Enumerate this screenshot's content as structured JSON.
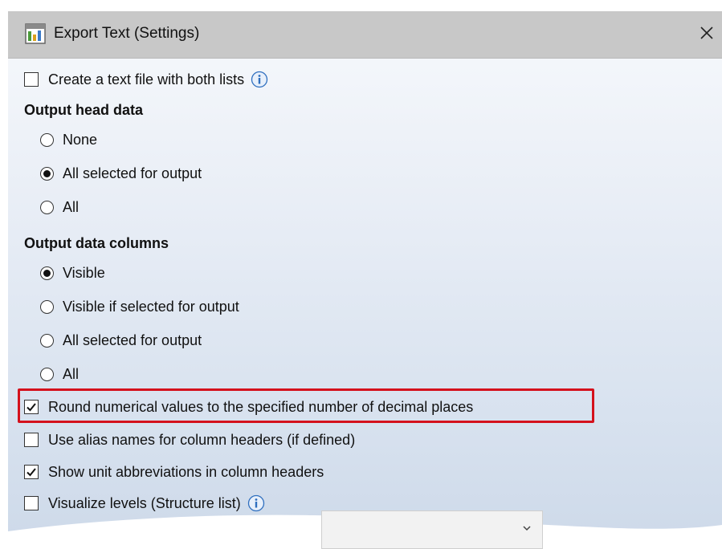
{
  "window": {
    "title": "Export Text (Settings)",
    "close_glyph": "✕"
  },
  "options": {
    "both_lists": {
      "label": "Create a text file with both lists",
      "checked": false,
      "icon": "info-icon"
    },
    "head_data": {
      "heading": "Output head data",
      "items": [
        {
          "label": "None",
          "selected": false
        },
        {
          "label": "All selected for output",
          "selected": true
        },
        {
          "label": "All",
          "selected": false
        }
      ]
    },
    "data_columns": {
      "heading": "Output data columns",
      "items": [
        {
          "label": "Visible",
          "selected": true
        },
        {
          "label": "Visible if selected for output",
          "selected": false
        },
        {
          "label": "All selected for output",
          "selected": false
        },
        {
          "label": "All",
          "selected": false
        }
      ]
    },
    "round_values": {
      "label": "Round numerical values to the specified number of decimal places",
      "checked": true
    },
    "alias_names": {
      "label": "Use alias names for column headers (if defined)",
      "checked": false
    },
    "unit_abbrev": {
      "label": "Show unit abbreviations in column headers",
      "checked": true
    },
    "visualize_levels": {
      "label": "Visualize levels (Structure list)",
      "checked": false,
      "icon": "info-icon"
    }
  },
  "colors": {
    "highlight": "#d4111c",
    "titlebar": "#c8c8c8",
    "info_blue": "#2f6fbf"
  }
}
